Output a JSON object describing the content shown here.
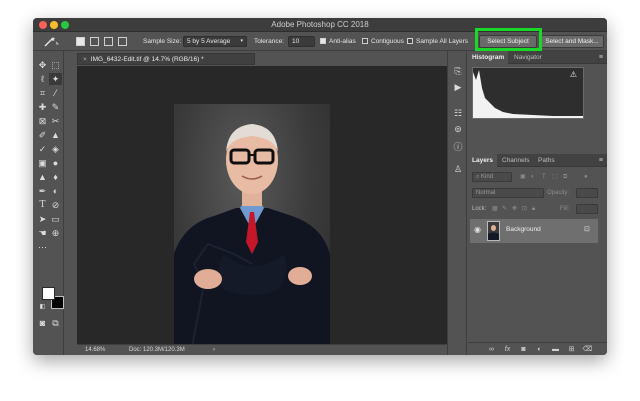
{
  "window": {
    "title": "Adobe Photoshop CC 2018"
  },
  "options_bar": {
    "tool_icon": "quick-selection-wand",
    "sample_size_label": "Sample Size:",
    "sample_size_value": "5 by 5 Average",
    "tolerance_label": "Tolerance:",
    "tolerance_value": "10",
    "anti_alias_label": "Anti-alias",
    "anti_alias_checked": true,
    "contiguous_label": "Contiguous",
    "contiguous_checked": false,
    "sample_all_layers_label": "Sample All Layers",
    "sample_all_layers_checked": false,
    "select_subject_label": "Select Subject",
    "select_and_mask_label": "Select and Mask...",
    "highlight_color": "#19d829"
  },
  "document": {
    "tab_close": "×",
    "tab_label": "IMG_6432-Edit.tif @ 14.7% (RGB/16) *"
  },
  "status_bar": {
    "zoom": "14.68%",
    "doc_info": "Doc: 120.3M/120.3M",
    "arrow": "›"
  },
  "panels": {
    "histogram_tabs": [
      "Histogram",
      "Navigator"
    ],
    "histogram_warning": "⚠",
    "layers_tabs": [
      "Layers",
      "Channels",
      "Paths"
    ],
    "kind_filter": "Kind",
    "blend_mode": "Normal",
    "opacity_label": "Opacity:",
    "lock_label": "Lock:",
    "fill_label": "Fill:",
    "menu_icon": "≡"
  },
  "layers": [
    {
      "name": "Background",
      "visible": true,
      "locked": true
    }
  ],
  "colors": {
    "foreground": "#ffffff",
    "background": "#000000"
  }
}
